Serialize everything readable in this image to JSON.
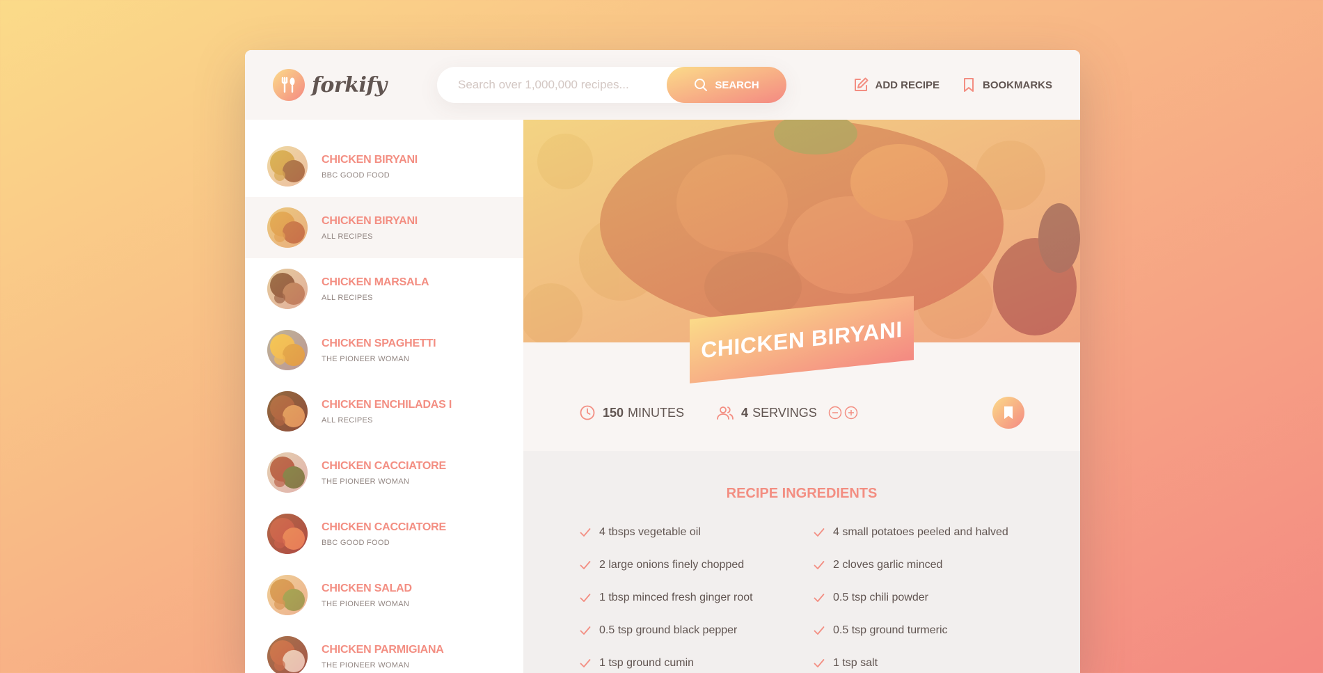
{
  "colors": {
    "accent": "#f38e82",
    "gradient_start": "#fbdb89",
    "gradient_end": "#f48982",
    "text": "#615551",
    "muted": "#918581",
    "panel": "#f9f5f3"
  },
  "header": {
    "logo_text": "forkify",
    "search_placeholder": "Search over 1,000,000 recipes...",
    "search_button_label": "SEARCH",
    "add_recipe_label": "ADD RECIPE",
    "bookmarks_label": "BOOKMARKS"
  },
  "results": [
    {
      "title": "CHICKEN BIRYANI",
      "publisher": "BBC GOOD FOOD",
      "active": false,
      "thumb_colors": [
        "#c9a43b",
        "#8a5a2b",
        "#e8d9b0"
      ]
    },
    {
      "title": "CHICKEN BIRYANI",
      "publisher": "ALL RECIPES",
      "active": true,
      "thumb_colors": [
        "#d79a3a",
        "#b35f2c",
        "#e3c07a"
      ]
    },
    {
      "title": "CHICKEN MARSALA",
      "publisher": "ALL RECIPES",
      "active": false,
      "thumb_colors": [
        "#6b3b24",
        "#a8714c",
        "#d9c3a8"
      ]
    },
    {
      "title": "CHICKEN SPAGHETTI",
      "publisher": "THE PIONEER WOMAN",
      "active": false,
      "thumb_colors": [
        "#f0c13c",
        "#d9a12a",
        "#9e9e9e"
      ]
    },
    {
      "title": "CHICKEN ENCHILADAS I",
      "publisher": "ALL RECIPES",
      "active": false,
      "thumb_colors": [
        "#8c3f1f",
        "#d59148",
        "#5a2d16"
      ]
    },
    {
      "title": "CHICKEN CACCIATORE",
      "publisher": "THE PIONEER WOMAN",
      "active": false,
      "thumb_colors": [
        "#9c3a2b",
        "#4f6b2a",
        "#d8c9c4"
      ]
    },
    {
      "title": "CHICKEN CACCIATORE",
      "publisher": "BBC GOOD FOOD",
      "active": false,
      "thumb_colors": [
        "#b4372c",
        "#e07040",
        "#8a2a22"
      ]
    },
    {
      "title": "CHICKEN SALAD",
      "publisher": "THE PIONEER WOMAN",
      "active": false,
      "thumb_colors": [
        "#c9893c",
        "#7d9b3a",
        "#e9c89a"
      ]
    },
    {
      "title": "CHICKEN PARMIGIANA",
      "publisher": "THE PIONEER WOMAN",
      "active": false,
      "thumb_colors": [
        "#b24a2c",
        "#e2d3c8",
        "#7a3b2a"
      ]
    }
  ],
  "recipe": {
    "title": "CHICKEN BIRYANI",
    "cooking_time": "150",
    "cooking_time_unit": "MINUTES",
    "servings": "4",
    "servings_unit": "SERVINGS",
    "ingredients_heading": "RECIPE INGREDIENTS",
    "ingredients": [
      "4 tbsps vegetable oil",
      "4 small potatoes peeled and halved",
      "2 large onions finely chopped",
      "2 cloves garlic minced",
      "1 tbsp minced fresh ginger root",
      "0.5 tsp chili powder",
      "0.5 tsp ground black pepper",
      "0.5 tsp ground turmeric",
      "1 tsp ground cumin",
      "1 tsp salt"
    ]
  },
  "icons": {
    "logo": "fork-knife-icon",
    "search": "search-icon",
    "add_recipe": "edit-icon",
    "bookmarks": "bookmark-icon",
    "time": "clock-icon",
    "servings": "users-icon",
    "decrease": "minus-circle-icon",
    "increase": "plus-circle-icon",
    "ingredient": "check-icon"
  }
}
